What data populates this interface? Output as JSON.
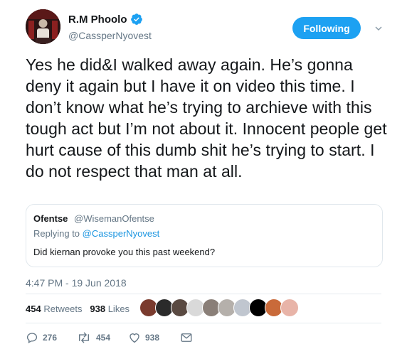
{
  "author": {
    "display_name": "R.M Phoolo",
    "handle": "@CassperNyovest",
    "verified": true,
    "avatar_icon": "profile-photo"
  },
  "follow_button": {
    "label": "Following",
    "color": "#1da1f2"
  },
  "menu_icon": "chevron-down-icon",
  "tweet": {
    "text": "Yes he did&I walked away again. He’s gonna deny it again but I have it on video this time. I don’t know what he’s trying to archieve with this tough act but I’m not about it. Innocent people get hurt cause of this dumb shit he’s trying to start. I do not respect that man at all."
  },
  "quoted_tweet": {
    "name": "Ofentse",
    "handle": "@WisemanOfentse",
    "replying_prefix": "Replying to",
    "replying_to": "@CassperNyovest",
    "text": "Did kiernan provoke you this past weekend?"
  },
  "timestamp": "4:47 PM - 19 Jun 2018",
  "stats": {
    "retweets_count": "454",
    "retweets_label": "Retweets",
    "likes_count": "938",
    "likes_label": "Likes"
  },
  "likers": [
    {
      "color": "#7a3b2e"
    },
    {
      "color": "#2b2b2b"
    },
    {
      "color": "#5a4a42"
    },
    {
      "color": "#d9d9d9"
    },
    {
      "color": "#8a7f78"
    },
    {
      "color": "#b5b0ab"
    },
    {
      "color": "#c0c6cf"
    },
    {
      "color": "#000000"
    },
    {
      "color": "#c96a3a"
    },
    {
      "color": "#e8b4a8"
    }
  ],
  "actions": {
    "reply_count": "276",
    "retweet_count": "454",
    "like_count": "938"
  },
  "colors": {
    "text": "#14171a",
    "secondary": "#657786",
    "link": "#1b95e0",
    "border": "#e1e8ed"
  }
}
